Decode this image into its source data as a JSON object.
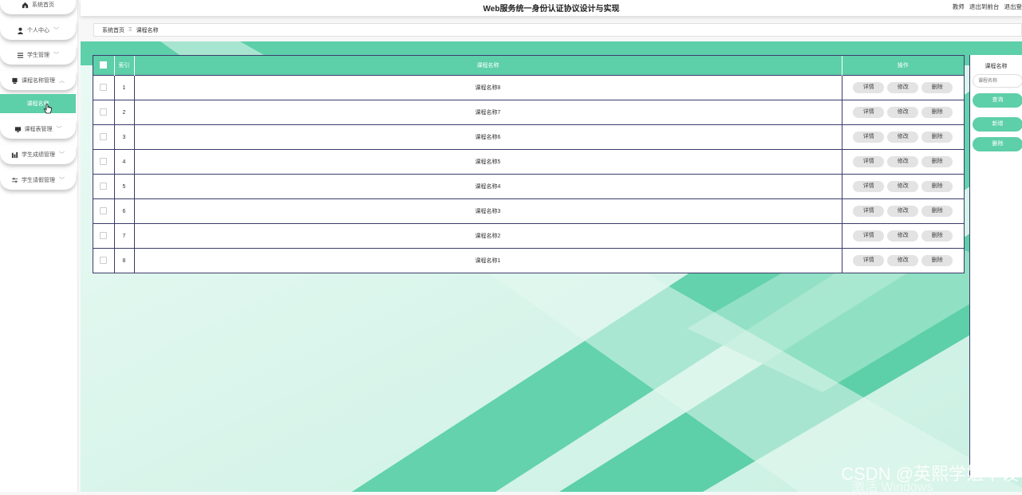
{
  "header": {
    "title": "Web服务统一身份认证协议设计与实现",
    "role": "教师",
    "back_to_front": "退出到前台",
    "logout": "退出登"
  },
  "breadcrumb": {
    "home": "系统首页",
    "separator": "Ξ",
    "current": "课程名称"
  },
  "sidebar": {
    "items": [
      {
        "label": "系统首页",
        "icon": "home-icon"
      },
      {
        "label": "个人中心",
        "icon": "user-icon"
      },
      {
        "label": "学生管理",
        "icon": "list-icon"
      },
      {
        "label": "课程名称管理",
        "icon": "folder-icon"
      },
      {
        "label": "课程表管理",
        "icon": "monitor-icon"
      },
      {
        "label": "学生成绩管理",
        "icon": "bar-chart-icon"
      },
      {
        "label": "学生请假管理",
        "icon": "sliders-icon"
      }
    ],
    "active_sub": "课程名称"
  },
  "table": {
    "headers": {
      "index": "索引",
      "name": "课程名称",
      "actions": "操作"
    },
    "rows": [
      {
        "index": "1",
        "name": "课程名称8"
      },
      {
        "index": "2",
        "name": "课程名称7"
      },
      {
        "index": "3",
        "name": "课程名称6"
      },
      {
        "index": "4",
        "name": "课程名称5"
      },
      {
        "index": "5",
        "name": "课程名称4"
      },
      {
        "index": "6",
        "name": "课程名称3"
      },
      {
        "index": "7",
        "name": "课程名称2"
      },
      {
        "index": "8",
        "name": "课程名称1"
      }
    ],
    "actions": {
      "detail": "详情",
      "edit": "修改",
      "delete": "删除"
    }
  },
  "search_panel": {
    "label": "课程名称",
    "placeholder": "课程名称",
    "query_button": "查询",
    "add_button": "新增",
    "delete_button": "删除"
  },
  "watermark": {
    "csdn": "CSDN @英熙学姐毕设",
    "windows": "激活 Windows"
  },
  "colors": {
    "accent": "#5dcfa9",
    "accent_dark": "#3fbf95",
    "table_border": "#3b3b6b"
  }
}
